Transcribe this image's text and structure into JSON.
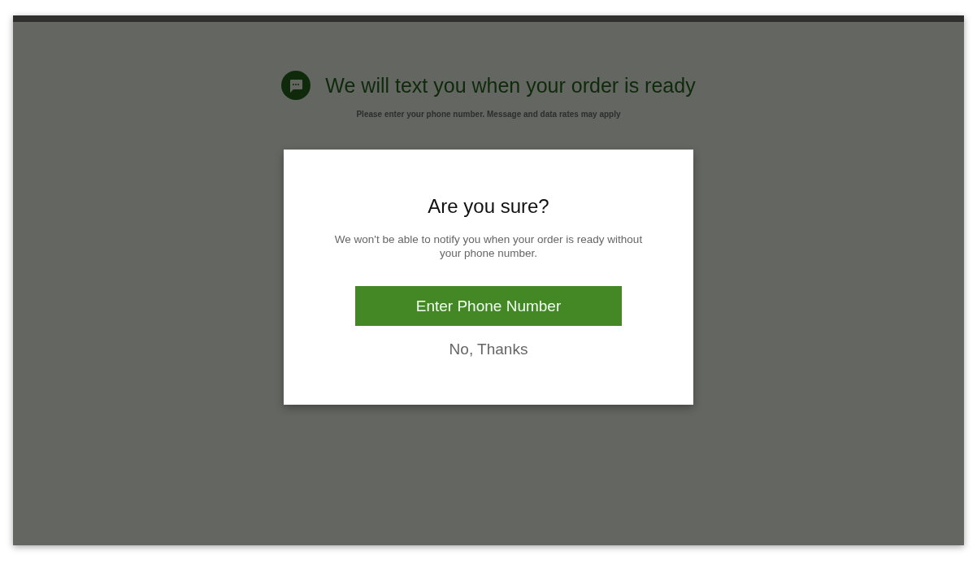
{
  "header": {
    "title": "We will text you when your order is ready",
    "subtitle": "Please enter your phone number. Message and data rates may apply"
  },
  "dialog": {
    "title": "Are you sure?",
    "message": "We won't be able to notify you when your order is ready without your phone number.",
    "buttons": [
      {
        "kind": "primary",
        "label": "Enter Phone Number"
      },
      {
        "kind": "text",
        "label": "No, Thanks"
      }
    ]
  }
}
